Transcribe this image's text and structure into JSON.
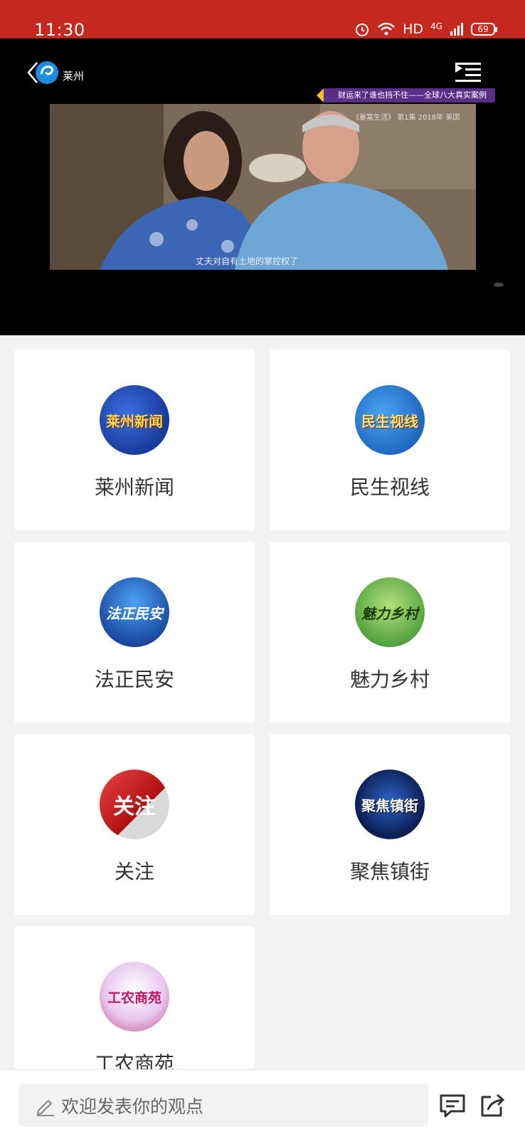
{
  "status": {
    "time": "11:30",
    "network": "HD",
    "cell": "4G",
    "battery": "69"
  },
  "player": {
    "logo_text": "莱州",
    "banner_text": "财运来了谁也挡不住——全球八大真实案例",
    "video_caption": "《暴富生活》 第1集 2018年 美国",
    "video_subtitle": "丈夫对自有土地的掌控权了"
  },
  "colors": {
    "status_bar": "#c4281f",
    "card_bg": "#ffffff",
    "page_bg": "#f2f2f2"
  },
  "programs": [
    {
      "label": "莱州新闻",
      "badge": "莱州新闻"
    },
    {
      "label": "民生视线",
      "badge": "民生视线"
    },
    {
      "label": "法正民安",
      "badge": "法正民安"
    },
    {
      "label": "魅力乡村",
      "badge": "魅力乡村"
    },
    {
      "label": "关注",
      "badge": "关注"
    },
    {
      "label": "聚焦镇街",
      "badge": "聚焦镇街"
    },
    {
      "label": "工农商苑",
      "badge": "工农商苑"
    }
  ],
  "comment_bar": {
    "placeholder": "欢迎发表你的观点",
    "comment_icon": "comment-icon",
    "share_icon": "share-icon"
  }
}
